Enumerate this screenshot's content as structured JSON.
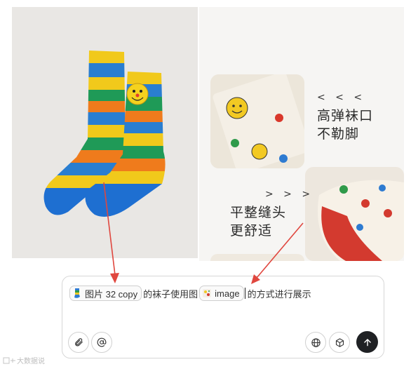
{
  "images": {
    "right_panel": {
      "feature_1": {
        "chevrons": "< < <",
        "line1": "高弹袜口",
        "line2": "不勒脚"
      },
      "feature_2": {
        "chevrons": "> > >",
        "line1": "平整缝头",
        "line2": "更舒适"
      }
    }
  },
  "composer": {
    "chip1_label": "图片 32 copy",
    "text1": "的袜子使用图",
    "chip2_label": "image",
    "text2": "的方式进行展示"
  },
  "icons": {
    "attach": "paperclip-icon",
    "mention": "at-sign-icon",
    "web": "globe-icon",
    "model": "cube-icon",
    "send": "arrow-up-icon"
  },
  "watermark": {
    "logo_text": "",
    "text": "大数据说"
  },
  "colors": {
    "arrow": "#e0473f",
    "send": "#1f2124"
  }
}
